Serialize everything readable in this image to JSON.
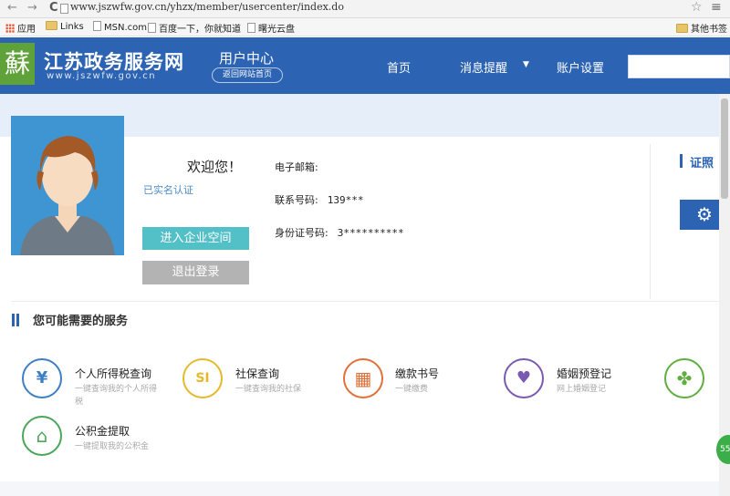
{
  "browser": {
    "back_glyph": "←",
    "forward_glyph": "→",
    "reload_glyph": "C",
    "url": "www.jszwfw.gov.cn/yhzx/member/usercenter/index.do",
    "star_glyph": "☆",
    "menu_glyph": "≡",
    "bookmarks": [
      "应用",
      "Links",
      "MSN.com",
      "百度一下，你就知道",
      "曙光云盘"
    ],
    "other_bookmarks": "其他书签"
  },
  "site": {
    "logo_glyph": "蘇",
    "name": "江苏政务服务网",
    "domain": "www.jszwfw.gov.cn",
    "user_center": "用户中心",
    "back_home": "返回网站首页",
    "nav": [
      "首页",
      "消息提醒",
      "账户设置"
    ],
    "nav_caret": "▼"
  },
  "profile": {
    "welcome": "欢迎您！",
    "realname_status": "已实名认证",
    "enter_enterprise": "进入企业空间",
    "logout": "退出登录",
    "fields": [
      {
        "label": "电子邮箱:",
        "value": ""
      },
      {
        "label": "联系号码:",
        "value": "139***"
      },
      {
        "label": "身份证号码:",
        "value": "3**********"
      }
    ],
    "cert_title": "证照",
    "gear_glyph": "⚙"
  },
  "services": {
    "title": "您可能需要的服务",
    "items": [
      {
        "title": "个人所得税查询",
        "desc": "一键查询我的个人所得税",
        "color": "#3d7fc4",
        "glyph": "¥"
      },
      {
        "title": "社保查询",
        "desc": "一键查询我的社保",
        "color": "#e6b92a",
        "glyph": "SI"
      },
      {
        "title": "缴款书号",
        "desc": "一键缴费",
        "color": "#e0703a",
        "glyph": "▦"
      },
      {
        "title": "婚姻预登记",
        "desc": "网上婚姻登记",
        "color": "#7a5ab0",
        "glyph": "♥"
      },
      {
        "title": "",
        "desc": "",
        "color": "#5fae3f",
        "glyph": "✤"
      },
      {
        "title": "公积金提取",
        "desc": "一键提取我的公积金",
        "color": "#4aa65a",
        "glyph": "⌂"
      }
    ]
  },
  "float_badge": "55"
}
